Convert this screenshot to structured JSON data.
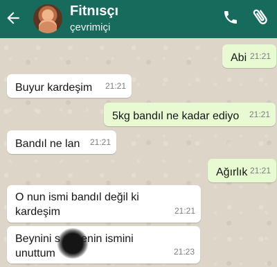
{
  "header": {
    "contact_name": "Fitnısçı",
    "status": "çevrimiçi"
  },
  "messages": [
    {
      "text": "Abi",
      "time": "21:21",
      "side": "outgoing"
    },
    {
      "text": "Buyur kardeşim",
      "time": "21:21",
      "side": "incoming"
    },
    {
      "text": "5kg bandıl ne kadar ediyo",
      "time": "21:21",
      "side": "outgoing"
    },
    {
      "text": "Bandıl ne lan",
      "time": "21:21",
      "side": "incoming"
    },
    {
      "text": "Ağırlık",
      "time": "21:21",
      "side": "outgoing"
    },
    {
      "text": "O nun ismi bandıl değil ki kardeşim",
      "time": "21:21",
      "side": "incoming"
    },
    {
      "text": "Beynini s      m senin  ismini unuttum",
      "time": "21:23",
      "side": "incoming"
    }
  ],
  "icons": [
    "back-arrow-icon",
    "avatar",
    "phone-icon",
    "paperclip-icon"
  ],
  "colors": {
    "header": "#176b5c",
    "incoming_bubble": "#ffffff",
    "outgoing_bubble": "#e8fad2",
    "chat_background": "#ddd5c8"
  }
}
